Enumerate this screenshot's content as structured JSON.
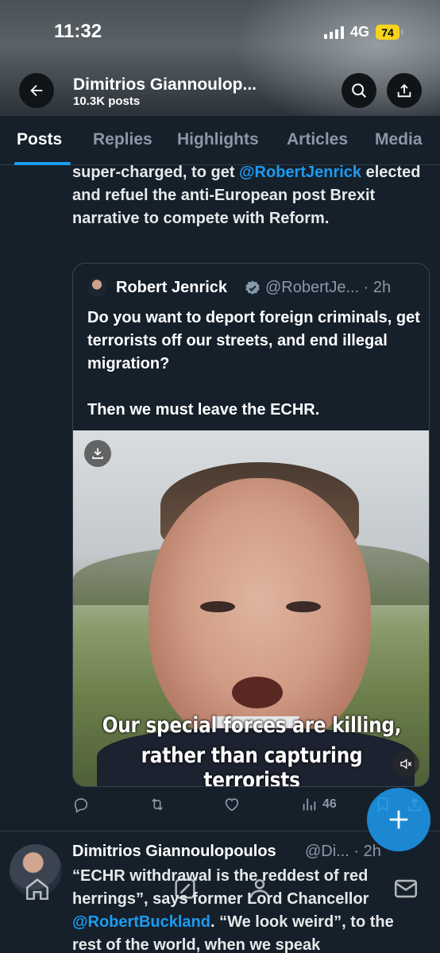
{
  "status_bar": {
    "time": "11:32",
    "network": "4G",
    "battery": "74"
  },
  "header": {
    "title": "Dimitrios Giannoulop...",
    "subtitle": "10.3K posts"
  },
  "tabs": [
    {
      "label": "Posts",
      "active": true
    },
    {
      "label": "Replies",
      "active": false
    },
    {
      "label": "Highlights",
      "active": false
    },
    {
      "label": "Articles",
      "active": false
    },
    {
      "label": "Media",
      "active": false
    }
  ],
  "post": {
    "text_part1": "super-charged, to get ",
    "mention": "@RobertJenrick",
    "text_part2": " elected and refuel the anti-European post Brexit narrative to compete with Reform."
  },
  "quote": {
    "author_name": "Robert Jenrick",
    "handle_time": "@RobertJe... · 2h",
    "text": "Do you want to deport foreign criminals, get terrorists off our streets, and end illegal migration?\n\nThen we must leave the ECHR.",
    "caption_line1": "Our special forces are killing,",
    "caption_line2": "rather than capturing terrorists"
  },
  "actions": {
    "views": "46"
  },
  "second_post": {
    "author_name": "Dimitrios Giannoulopoulos",
    "handle_time": "@Di... · 2h",
    "text_part1": "“ECHR withdrawal is the reddest of red herrings”, says former Lord Chancellor ",
    "mention": "@RobertBuckland",
    "text_part2": ". “We look weird”, to the rest of the world, when we speak"
  },
  "colors": {
    "background": "#15202b",
    "accent": "#1d9bf0",
    "muted": "#8b98a5",
    "battery": "#f7d31b"
  },
  "icons": [
    "back-arrow-icon",
    "search-icon",
    "share-icon",
    "verified-icon",
    "download-icon",
    "mute-icon",
    "reply-icon",
    "retweet-icon",
    "like-icon",
    "views-icon",
    "bookmark-icon",
    "share-post-icon",
    "compose-plus-icon",
    "home-icon",
    "grok-icon",
    "communities-icon",
    "messages-icon"
  ]
}
